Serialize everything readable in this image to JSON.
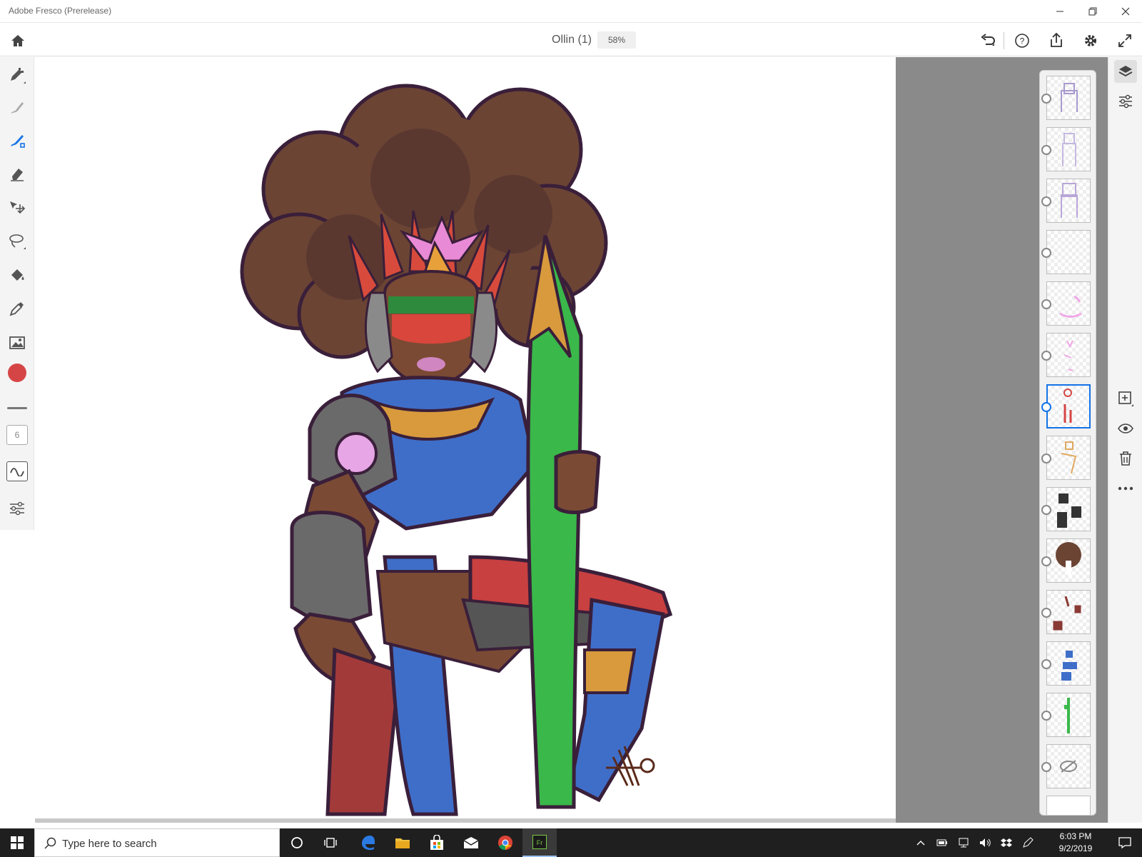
{
  "window": {
    "title": "Adobe Fresco (Prerelease)"
  },
  "document": {
    "name": "Ollin (1)",
    "zoom": "58%"
  },
  "toolbar": {
    "brush_size": "6",
    "active_color": "#d64545"
  },
  "layers": {
    "count": 14,
    "selected_index": 6
  },
  "taskbar": {
    "search_placeholder": "Type here to search",
    "time": "6:03 PM",
    "date": "9/2/2019"
  },
  "colors": {
    "accent": "#1473e6",
    "workspace": "#8a8a8a"
  }
}
